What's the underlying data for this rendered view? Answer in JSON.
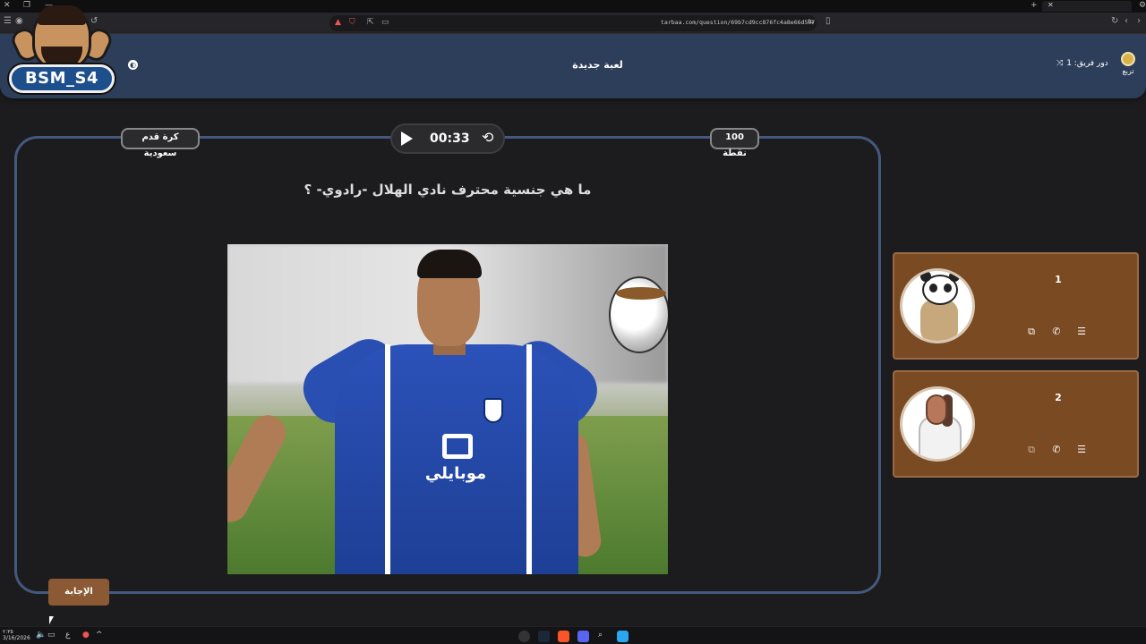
{
  "browser": {
    "url": "tarbaa.com/question/69b7cd9cc876fc4a8e66d597",
    "tab_label": "",
    "colors": {
      "bg": "#0f0f10",
      "bar": "#26262a"
    }
  },
  "streamer_overlay": {
    "name": "BSM_S4"
  },
  "header": {
    "title": "لعبة جديدة",
    "turn_label": "دور فريق: 1",
    "logo_label": "تربع",
    "colors": {
      "bg": "#2d3e5a"
    }
  },
  "question_card": {
    "category": "كرة قدم سعودية",
    "points": "100 نقطة",
    "timer": "00:33",
    "question": "ما هي جنسية محترف نادي الهلال -رادوي- ؟",
    "sponsor_text": "موبايلي",
    "colors": {
      "border": "#44597d"
    }
  },
  "answer_button": {
    "label": "الإجابة",
    "color": "#8b5a34"
  },
  "teams": [
    {
      "number": "1",
      "avatar": "panda-avatar",
      "color": "#7a4a22"
    },
    {
      "number": "2",
      "avatar": "horse-avatar",
      "color": "#7a4a22"
    }
  ],
  "taskbar": {
    "time": "٢:٣٥",
    "date": "3/16/2026"
  }
}
